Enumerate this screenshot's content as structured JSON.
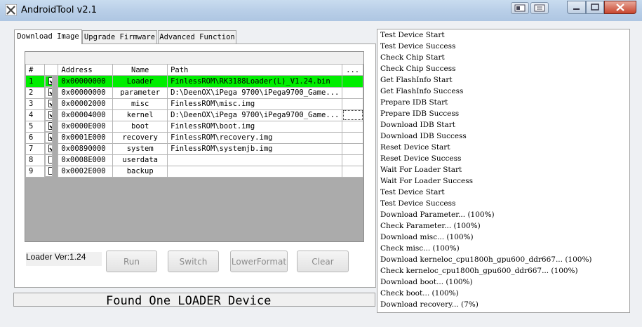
{
  "window": {
    "title": "AndroidTool v2.1"
  },
  "tabs": [
    {
      "label": "Download Image"
    },
    {
      "label": "Upgrade Firmware"
    },
    {
      "label": "Advanced Function"
    }
  ],
  "table": {
    "headers": {
      "num": "#",
      "address": "Address",
      "name": "Name",
      "path": "Path",
      "more": "..."
    },
    "rows": [
      {
        "num": "1",
        "checked": true,
        "address": "0x00000000",
        "name": "Loader",
        "path": "FinlessROM\\RK3188Loader(L)_V1.24.bin"
      },
      {
        "num": "2",
        "checked": true,
        "address": "0x00000000",
        "name": "parameter",
        "path": "D:\\DeenOX\\iPega 9700\\iPega9700_Game..."
      },
      {
        "num": "3",
        "checked": true,
        "address": "0x00002000",
        "name": "misc",
        "path": "FinlessROM\\misc.img"
      },
      {
        "num": "4",
        "checked": true,
        "address": "0x00004000",
        "name": "kernel",
        "path": "D:\\DeenOX\\iPega 9700\\iPega9700_Game..."
      },
      {
        "num": "5",
        "checked": true,
        "address": "0x0000E000",
        "name": "boot",
        "path": "FinlessROM\\boot.img"
      },
      {
        "num": "6",
        "checked": true,
        "address": "0x0001E000",
        "name": "recovery",
        "path": "FinlessROM\\recovery.img"
      },
      {
        "num": "7",
        "checked": true,
        "address": "0x00890000",
        "name": "system",
        "path": "FinlessROM\\systemjb.img"
      },
      {
        "num": "8",
        "checked": false,
        "address": "0x0008E000",
        "name": "userdata",
        "path": ""
      },
      {
        "num": "9",
        "checked": false,
        "address": "0x0002E000",
        "name": "backup",
        "path": ""
      }
    ]
  },
  "loader_ver": "Loader Ver:1.24",
  "buttons": {
    "run": "Run",
    "switch": "Switch",
    "lowerformat": "LowerFormat",
    "clear": "Clear"
  },
  "status": "Found One LOADER Device",
  "log": [
    "Test Device Start",
    "Test Device Success",
    "Check Chip Start",
    " Check Chip Success",
    "Get FlashInfo Start",
    "Get FlashInfo Success",
    "Prepare IDB Start",
    "Prepare IDB Success",
    "Download IDB Start",
    "Download IDB Success",
    "Reset Device Start",
    "Reset Device Success",
    "Wait For Loader Start",
    "Wait For Loader Success",
    "Test Device Start",
    "Test Device Success",
    "Download Parameter... (100%)",
    "Check Parameter... (100%)",
    "Download misc... (100%)",
    "Check misc... (100%)",
    "Download kerneloc_cpu1800h_gpu600_ddr667... (100%)",
    "Check kerneloc_cpu1800h_gpu600_ddr667... (100%)",
    "Download boot... (100%)",
    "Check boot... (100%)",
    "Download recovery... (7%)"
  ],
  "colors": {
    "selected_row": "#00ee00"
  }
}
